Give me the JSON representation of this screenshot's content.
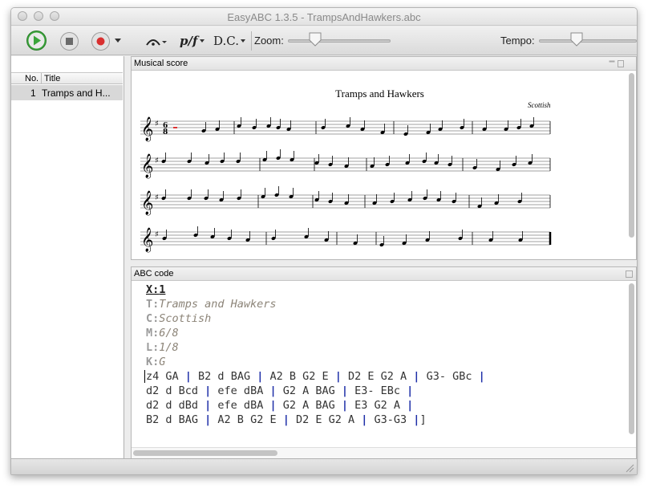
{
  "window": {
    "title": "EasyABC 1.3.5 - TrampsAndHawkers.abc"
  },
  "toolbar": {
    "dynamics_label": "p/f",
    "dc_label": "D.C.",
    "zoom_label": "Zoom:",
    "tempo_label": "Tempo:",
    "zoom_level": 0.25,
    "tempo_level": 0.35,
    "icons": [
      "play-icon",
      "stop-icon",
      "record-icon",
      "fermata-icon"
    ]
  },
  "tune_list": {
    "columns": [
      "No.",
      "Title"
    ],
    "rows": [
      {
        "no": "1",
        "title": "Tramps and H..."
      }
    ]
  },
  "score_panel": {
    "title": "Musical score",
    "tune_title": "Tramps and Hawkers",
    "composer": "Scottish",
    "time_numerator": "6",
    "time_denominator": "8"
  },
  "abc_panel": {
    "title": "ABC code",
    "header": [
      {
        "key": "X:",
        "value": "1"
      },
      {
        "key": "T:",
        "value": "Tramps and Hawkers"
      },
      {
        "key": "C:",
        "value": "Scottish"
      },
      {
        "key": "M:",
        "value": "6/8"
      },
      {
        "key": "L:",
        "value": "1/8"
      },
      {
        "key": "K:",
        "value": "G"
      }
    ],
    "music_lines": [
      [
        "z4 GA ",
        " B2 d BAG ",
        " A2 B G2 E ",
        " D2 E G2 A ",
        " G3- GBc ",
        ""
      ],
      [
        "d2 d Bcd ",
        " efe dBA ",
        " G2 A BAG ",
        " E3- EBc ",
        ""
      ],
      [
        "d2 d dBd ",
        " efe dBA ",
        " G2 A BAG ",
        " E3 G2 A ",
        ""
      ],
      [
        "B2 d BAG ",
        " A2 B G2 E ",
        " D2 E G2 A ",
        " G3-G3 ",
        "]"
      ]
    ]
  },
  "colors": {
    "bar_blue": "#1f2fa8",
    "play_green": "#3aa53a",
    "record_red": "#d93030",
    "header_key": "#9a9a9a",
    "header_value": "#8c8478"
  }
}
